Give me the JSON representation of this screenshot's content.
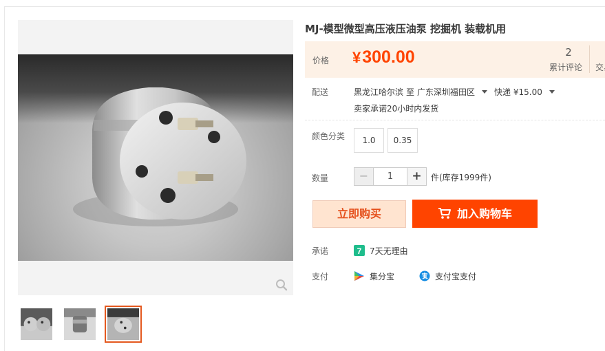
{
  "product": {
    "title": "MJ-模型微型高压液压油泵 挖掘机 装载机用"
  },
  "price": {
    "label": "价格",
    "currency": "¥",
    "value": "300.00",
    "review_count": "2",
    "review_label": "累计评论",
    "trade_label": "交易成功"
  },
  "shipping": {
    "label": "配送",
    "from": "黑龙江哈尔滨",
    "to_word": "至",
    "destination": "广东深圳福田区",
    "method": "快递 ¥15.00",
    "promise": "卖家承诺20小时内发货"
  },
  "sku": {
    "label": "颜色分类",
    "options": [
      "1.0",
      "0.35"
    ]
  },
  "quantity": {
    "label": "数量",
    "value": "1",
    "minus": "−",
    "plus": "+",
    "stock_text": "件(库存1999件)"
  },
  "actions": {
    "buy_now": "立即购买",
    "add_cart": "加入购物车"
  },
  "promise": {
    "label": "承诺",
    "badge": "7",
    "text": "7天无理由"
  },
  "payment": {
    "label": "支付",
    "methods": [
      "集分宝",
      "支付宝支付"
    ]
  },
  "colors": {
    "accent": "#ff4400",
    "price_bg": "#fdf1e6",
    "buy_now_bg": "#ffe4d0",
    "promise_badge": "#1fbd8c",
    "thumb_active": "#e4581e"
  },
  "icons": {
    "zoom": "magnifier-icon",
    "cart": "cart-icon",
    "promise": "seven-day-icon",
    "jifenbao": "jifenbao-icon",
    "alipay": "alipay-icon"
  }
}
